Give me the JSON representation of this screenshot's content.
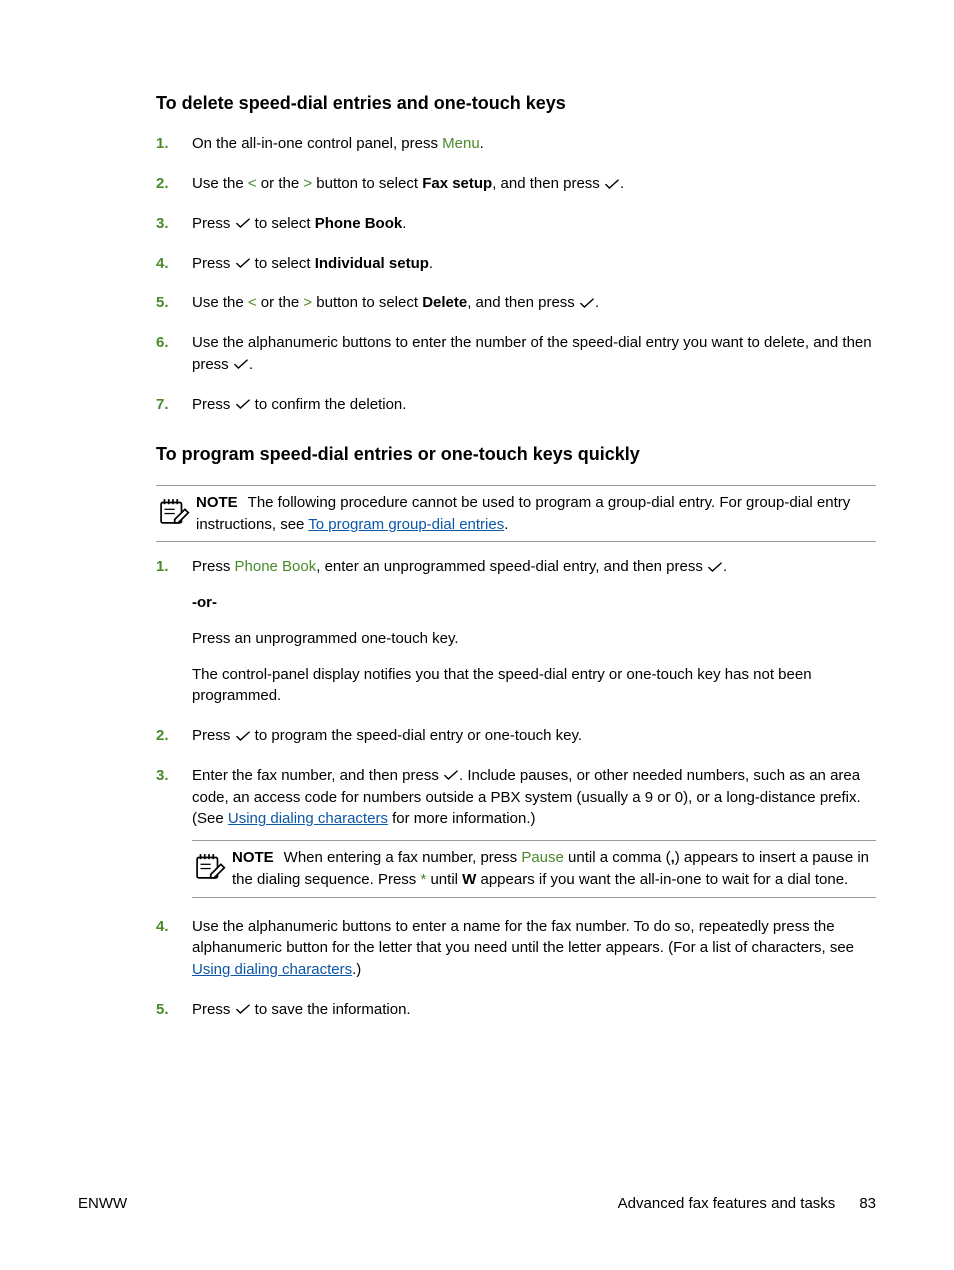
{
  "section1": {
    "heading": "To delete speed-dial entries and one-touch keys",
    "steps": {
      "s1": {
        "n": "1.",
        "pre": "On the all-in-one control panel, press ",
        "menu": "Menu",
        "post": "."
      },
      "s2": {
        "n": "2.",
        "a": "Use the ",
        "lt": "<",
        "b": " or the ",
        "gt": ">",
        "c": " button to select ",
        "bold": "Fax setup",
        "d": ", and then press ",
        "e": "."
      },
      "s3": {
        "n": "3.",
        "a": "Press ",
        "b": " to select ",
        "bold": "Phone Book",
        "c": "."
      },
      "s4": {
        "n": "4.",
        "a": "Press ",
        "b": " to select ",
        "bold": "Individual setup",
        "c": "."
      },
      "s5": {
        "n": "5.",
        "a": "Use the ",
        "lt": "<",
        "b": " or the ",
        "gt": ">",
        "c": " button to select ",
        "bold": "Delete",
        "d": ", and then press ",
        "e": "."
      },
      "s6": {
        "n": "6.",
        "a": "Use the alphanumeric buttons to enter the number of the speed-dial entry you want to delete, and then press ",
        "b": "."
      },
      "s7": {
        "n": "7.",
        "a": "Press ",
        "b": " to confirm the deletion."
      }
    }
  },
  "section2": {
    "heading": "To program speed-dial entries or one-touch keys quickly",
    "note1": {
      "label": "NOTE",
      "a": "The following procedure cannot be used to program a group-dial entry. For group-dial entry instructions, see ",
      "link": "To program group-dial entries",
      "b": "."
    },
    "steps": {
      "s1": {
        "n": "1.",
        "a": "Press ",
        "pb": "Phone Book",
        "b": ", enter an unprogrammed speed-dial entry, and then press ",
        "c": ".",
        "or": "-or-",
        "p2": "Press an unprogrammed one-touch key.",
        "p3": "The control-panel display notifies you that the speed-dial entry or one-touch key has not been programmed."
      },
      "s2": {
        "n": "2.",
        "a": "Press ",
        "b": " to program the speed-dial entry or one-touch key."
      },
      "s3": {
        "n": "3.",
        "a": "Enter the fax number, and then press ",
        "b": ". Include pauses, or other needed numbers, such as an area code, an access code for numbers outside a PBX system (usually a 9 or 0), or a long-distance prefix. (See ",
        "link": "Using dialing characters",
        "c": " for more information.)",
        "note": {
          "label": "NOTE",
          "a": "When entering a fax number, press ",
          "pause": "Pause",
          "b": " until a comma (",
          "comma": ",",
          "c": ") appears to insert a pause in the dialing sequence. Press ",
          "star": "*",
          "d": " until ",
          "w": "W",
          "e": " appears if you want the all-in-one to wait for a dial tone."
        }
      },
      "s4": {
        "n": "4.",
        "a": "Use the alphanumeric buttons to enter a name for the fax number. To do so, repeatedly press the alphanumeric button for the letter that you need until the letter appears. (For a list of characters, see ",
        "link": "Using dialing characters",
        "b": ".)"
      },
      "s5": {
        "n": "5.",
        "a": "Press ",
        "b": " to save the information."
      }
    }
  },
  "footer": {
    "left": "ENWW",
    "center": "Advanced fax features and tasks",
    "page": "83"
  }
}
